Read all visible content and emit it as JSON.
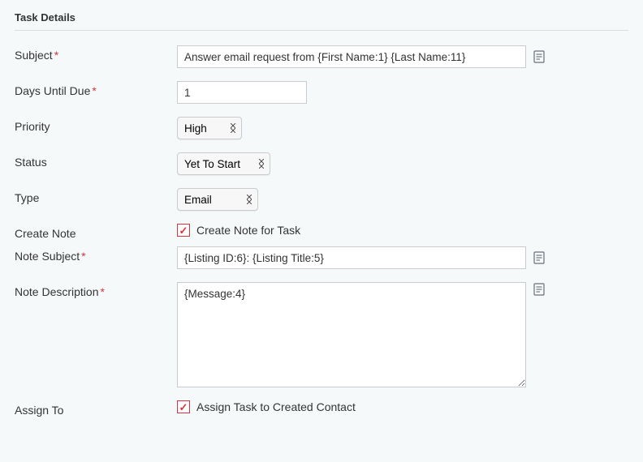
{
  "panel": {
    "title": "Task Details"
  },
  "fields": {
    "subject": {
      "label": "Subject",
      "required": true,
      "value": "Answer email request from {First Name:1} {Last Name:11}"
    },
    "days_until_due": {
      "label": "Days Until Due",
      "required": true,
      "value": "1"
    },
    "priority": {
      "label": "Priority",
      "value": "High"
    },
    "status": {
      "label": "Status",
      "value": "Yet To Start"
    },
    "type": {
      "label": "Type",
      "value": "Email"
    },
    "create_note": {
      "label": "Create Note",
      "checkbox_label": "Create Note for Task",
      "checked": true
    },
    "note_subject": {
      "label": "Note Subject",
      "required": true,
      "value": "{Listing ID:6}: {Listing Title:5}"
    },
    "note_description": {
      "label": "Note Description",
      "required": true,
      "value": "{Message:4}"
    },
    "assign_to": {
      "label": "Assign To",
      "checkbox_label": "Assign Task to Created Contact",
      "checked": true
    }
  }
}
